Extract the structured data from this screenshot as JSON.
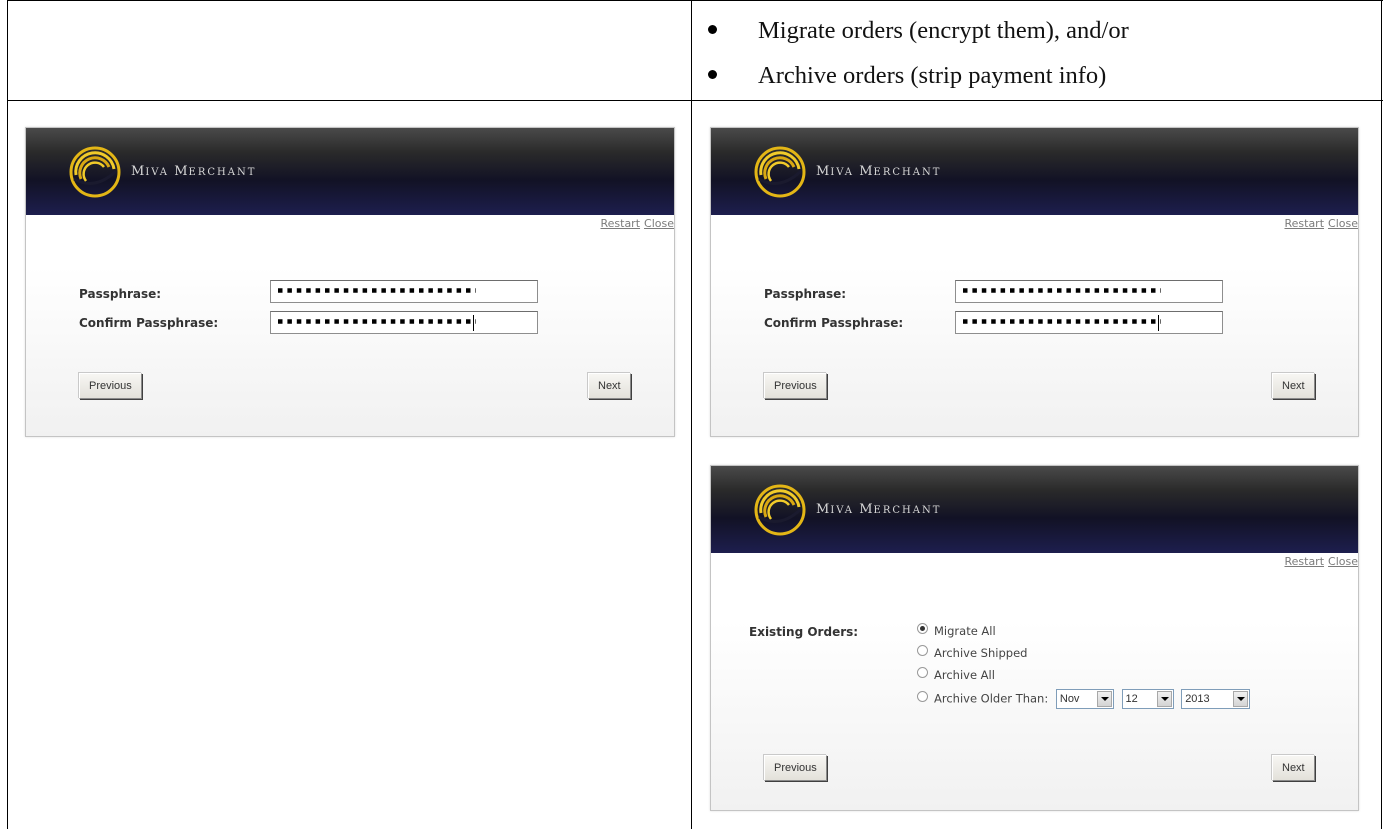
{
  "bullets": [
    "Migrate orders (encrypt them), and/or",
    "Archive orders (strip payment info)"
  ],
  "brand": "MIVA MERCHANT",
  "brand_parts": {
    "m1": "M",
    "r1": "IVA",
    "m2": "M",
    "r2": "ERCHANT"
  },
  "dialog_links": {
    "restart": "Restart",
    "close": "Close"
  },
  "passphrase_form": {
    "passphrase_label": "Passphrase:",
    "confirm_label": "Confirm Passphrase:"
  },
  "orders_form": {
    "label": "Existing Orders:",
    "options": [
      "Migrate All",
      "Archive Shipped",
      "Archive All",
      "Archive Older Than:"
    ],
    "selected": "Migrate All",
    "month": "Nov",
    "day": "12",
    "year": "2013"
  },
  "buttons": {
    "previous": "Previous",
    "next": "Next"
  },
  "colors": {
    "banner_dark": "#121225",
    "banner_blue": "#1d1e4e",
    "logo_gold": "#e3b616"
  }
}
